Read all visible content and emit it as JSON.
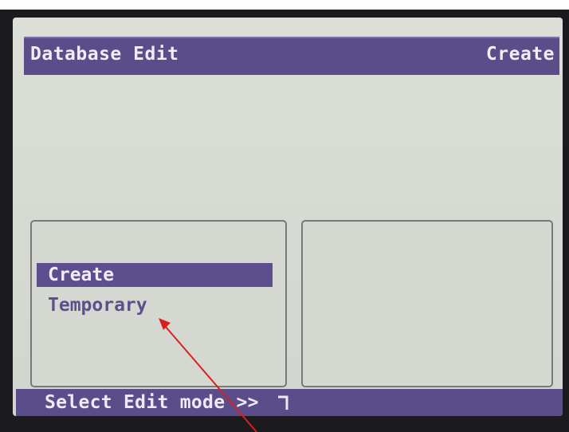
{
  "header": {
    "title": "Database Edit",
    "mode": "Create"
  },
  "menu": {
    "items": [
      {
        "label": "Create",
        "selected": true
      },
      {
        "label": "Temporary",
        "selected": false
      }
    ]
  },
  "status": {
    "text": "Select Edit mode >>"
  },
  "colors": {
    "accent": "#5a4d8a",
    "screen_bg": "#d8dad4",
    "annotation_arrow": "#d62020"
  },
  "icons": {
    "enter": "enter-return-icon"
  }
}
